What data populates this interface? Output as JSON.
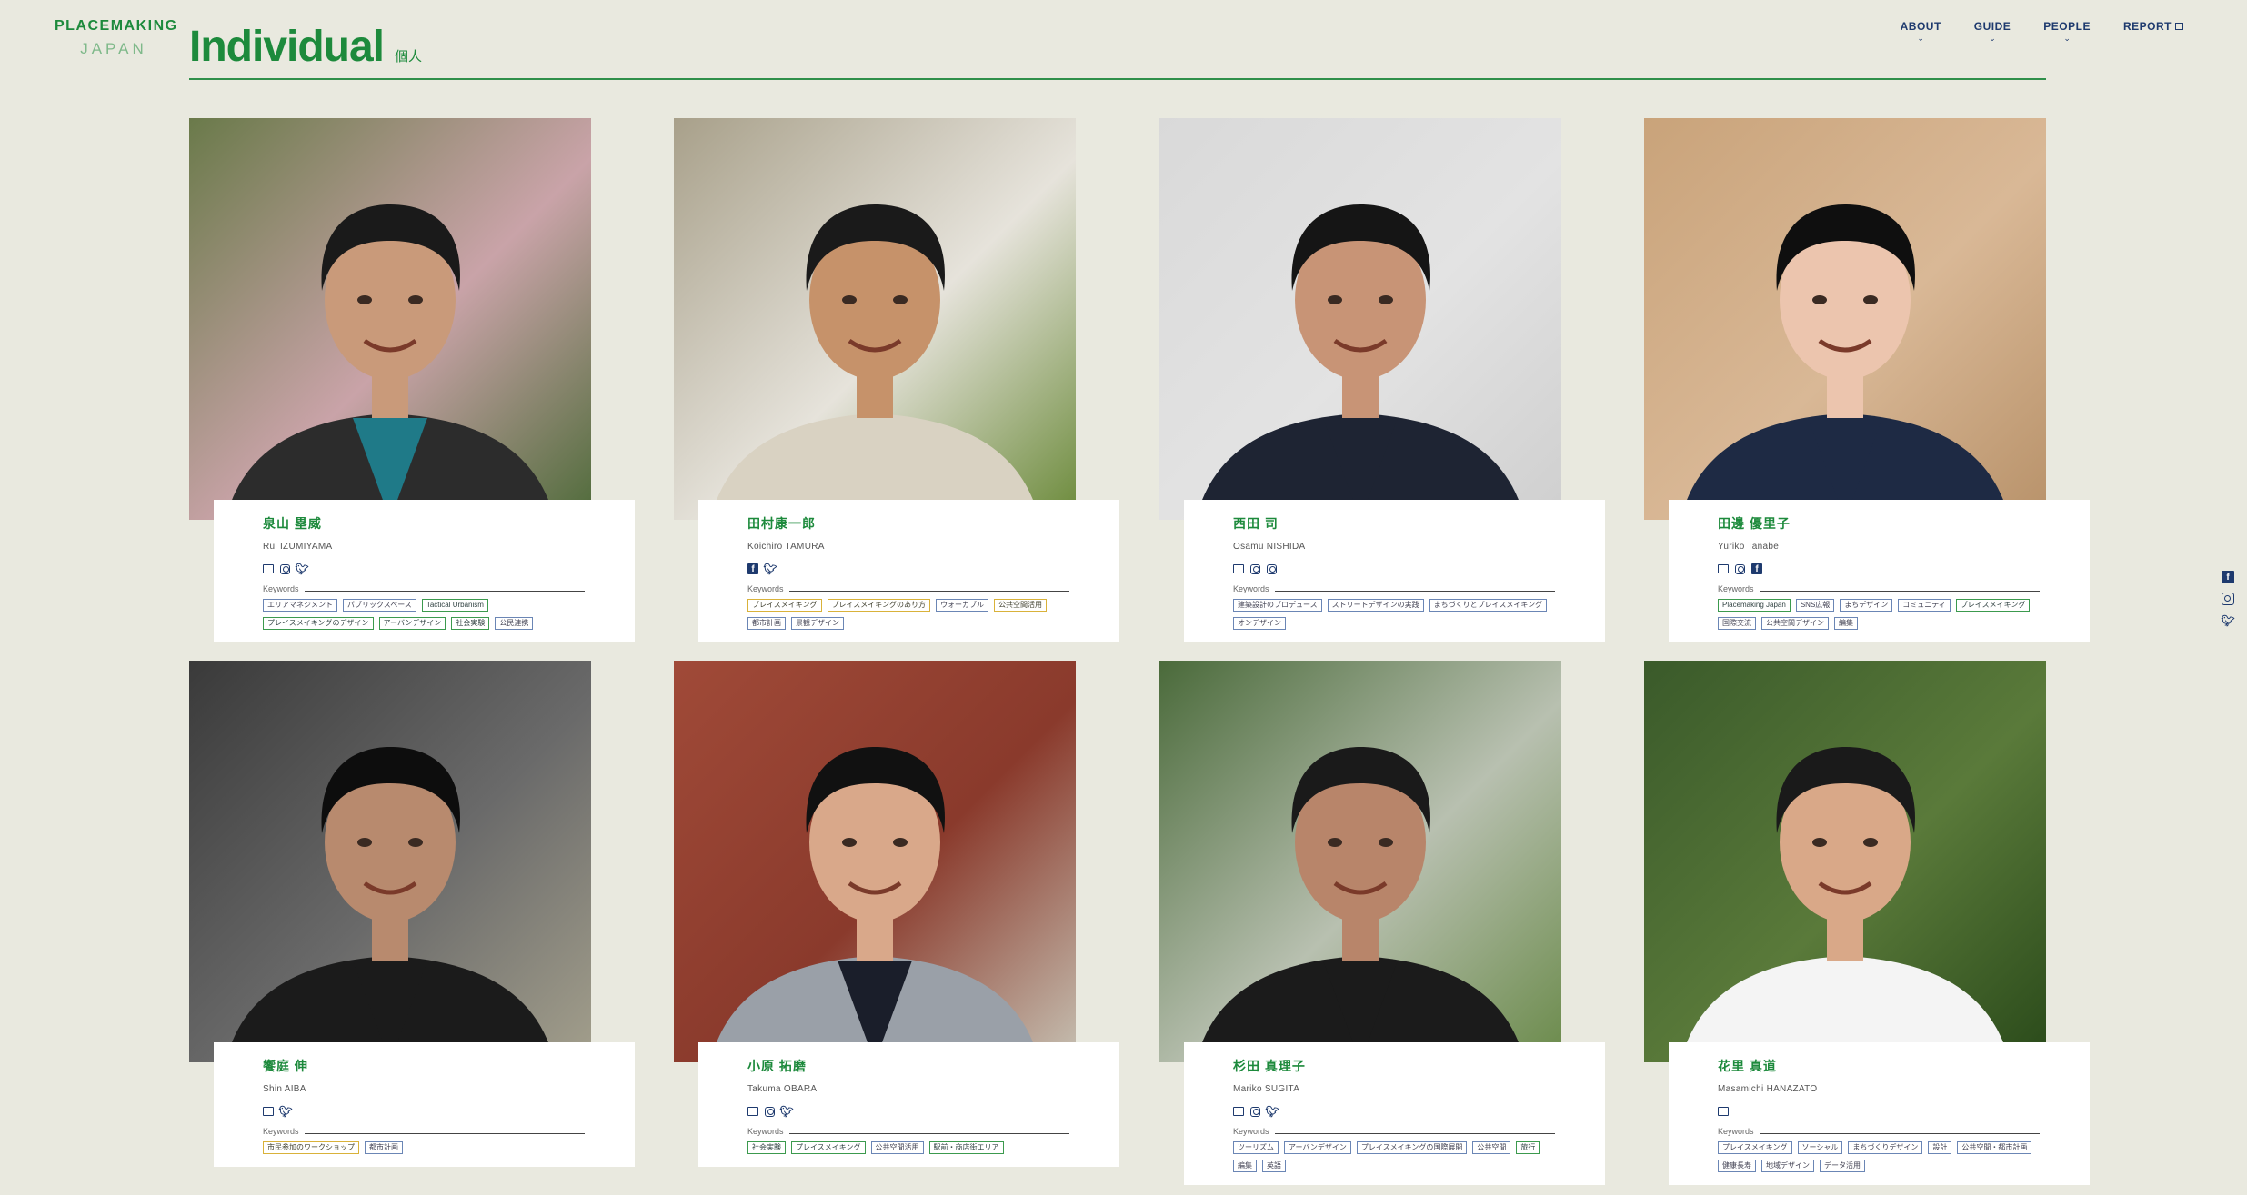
{
  "logo": {
    "line1": "PLACEMAKING",
    "line2": "JAPAN"
  },
  "page": {
    "title": "Individual",
    "subtitle": "個人"
  },
  "nav": [
    {
      "label": "ABOUT"
    },
    {
      "label": "GUIDE"
    },
    {
      "label": "PEOPLE"
    },
    {
      "label": "REPORT"
    }
  ],
  "keywords_label": "Keywords",
  "people": [
    {
      "name_ja": "泉山 塁威",
      "name_en": "Rui IZUMIYAMA",
      "socials": [
        "monitor",
        "instagram",
        "twitter"
      ],
      "tags": [
        [
          "エリアマネジメント",
          "b"
        ],
        [
          "パブリックスペース",
          "b"
        ],
        [
          "Tactical Urbanism",
          "g"
        ],
        [
          "プレイスメイキングのデザイン",
          "g"
        ],
        [
          "アーバンデザイン",
          "g"
        ],
        [
          "社会実験",
          "g"
        ],
        [
          "公民連携",
          "b"
        ]
      ]
    },
    {
      "name_ja": "田村康一郎",
      "name_en": "Koichiro TAMURA",
      "socials": [
        "facebook",
        "twitter"
      ],
      "tags": [
        [
          "プレイスメイキング",
          "y"
        ],
        [
          "プレイスメイキングのあり方",
          "y"
        ],
        [
          "ウォーカブル",
          "b"
        ],
        [
          "公共空間活用",
          "y"
        ],
        [
          "都市計画",
          "b"
        ],
        [
          "景観デザイン",
          "b"
        ]
      ]
    },
    {
      "name_ja": "西田 司",
      "name_en": "Osamu NISHIDA",
      "socials": [
        "monitor",
        "instagram",
        "instagram"
      ],
      "tags": [
        [
          "建築設計のプロデュース",
          "b"
        ],
        [
          "ストリートデザインの実践",
          "b"
        ],
        [
          "まちづくりとプレイスメイキング",
          "b"
        ],
        [
          "オンデザイン",
          "b"
        ]
      ]
    },
    {
      "name_ja": "田邊 優里子",
      "name_en": "Yuriko Tanabe",
      "socials": [
        "monitor",
        "instagram",
        "facebook"
      ],
      "tags": [
        [
          "Placemaking Japan",
          "g"
        ],
        [
          "SNS広報",
          "b"
        ],
        [
          "まちデザイン",
          "b"
        ],
        [
          "コミュニティ",
          "b"
        ],
        [
          "プレイスメイキング",
          "g"
        ],
        [
          "国際交流",
          "b"
        ],
        [
          "公共空間デザイン",
          "b"
        ],
        [
          "編集",
          "b"
        ]
      ]
    },
    {
      "name_ja": "饗庭 伸",
      "name_en": "Shin AIBA",
      "socials": [
        "monitor",
        "twitter"
      ],
      "tags": [
        [
          "市民参加のワークショップ",
          "y"
        ],
        [
          "都市計画",
          "b"
        ]
      ]
    },
    {
      "name_ja": "小原 拓磨",
      "name_en": "Takuma OBARA",
      "socials": [
        "monitor",
        "instagram",
        "twitter"
      ],
      "tags": [
        [
          "社会実験",
          "g"
        ],
        [
          "プレイスメイキング",
          "g"
        ],
        [
          "公共空間活用",
          "b"
        ],
        [
          "駅前・商店街エリア",
          "g"
        ]
      ]
    },
    {
      "name_ja": "杉田 真理子",
      "name_en": "Mariko SUGITA",
      "socials": [
        "monitor",
        "instagram",
        "twitter"
      ],
      "tags": [
        [
          "ツーリズム",
          "b"
        ],
        [
          "アーバンデザイン",
          "b"
        ],
        [
          "プレイスメイキングの国際展開",
          "b"
        ],
        [
          "公共空間",
          "b"
        ],
        [
          "旅行",
          "g"
        ],
        [
          "編集",
          "b"
        ],
        [
          "英語",
          "b"
        ]
      ]
    },
    {
      "name_ja": "花里 真道",
      "name_en": "Masamichi HANAZATO",
      "socials": [
        "monitor"
      ],
      "tags": [
        [
          "プレイスメイキング",
          "b"
        ],
        [
          "ソーシャル",
          "b"
        ],
        [
          "まちづくりデザイン",
          "b"
        ],
        [
          "設計",
          "b"
        ],
        [
          "公共空間・都市計画",
          "b"
        ],
        [
          "健康長寿",
          "b"
        ],
        [
          "地域デザイン",
          "b"
        ],
        [
          "データ活用",
          "b"
        ]
      ]
    }
  ],
  "side_socials": [
    "facebook",
    "instagram",
    "twitter"
  ]
}
